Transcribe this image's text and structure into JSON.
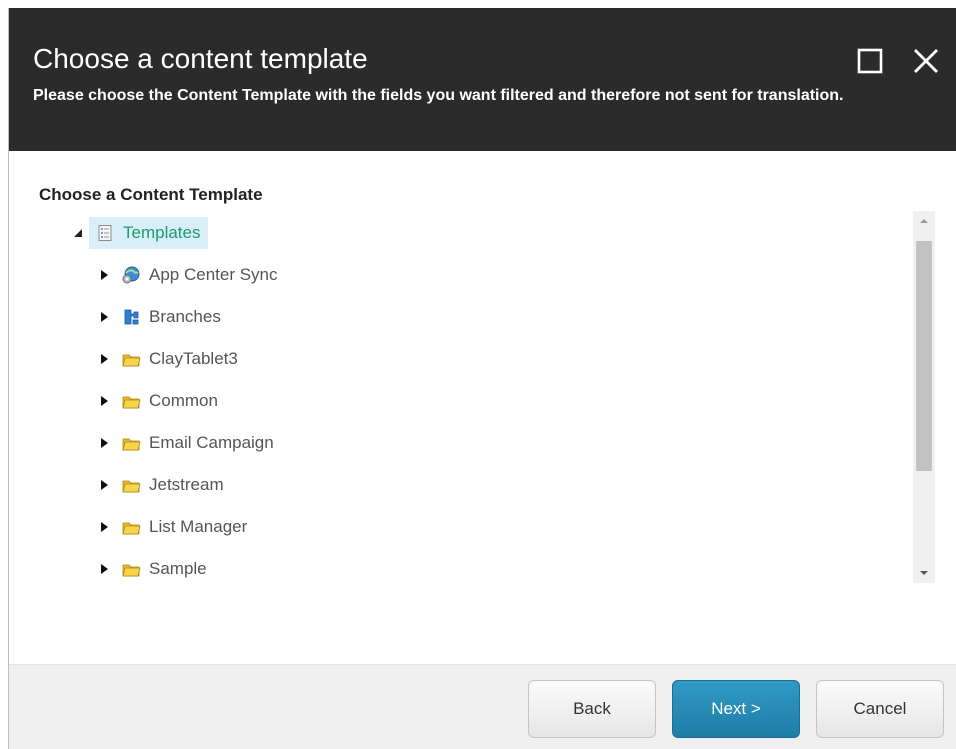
{
  "dialog": {
    "title": "Choose a content template",
    "subtitle": "Please choose the Content Template with the fields you want filtered and therefore not sent for translation."
  },
  "section": {
    "label": "Choose a Content Template"
  },
  "tree": {
    "root": {
      "label": "Templates",
      "icon": "template-icon",
      "expanded": true,
      "selected": true
    },
    "children": [
      {
        "label": "App Center Sync",
        "icon": "globe-gear-icon"
      },
      {
        "label": "Branches",
        "icon": "branches-icon"
      },
      {
        "label": "ClayTablet3",
        "icon": "folder-icon"
      },
      {
        "label": "Common",
        "icon": "folder-icon"
      },
      {
        "label": "Email Campaign",
        "icon": "folder-icon"
      },
      {
        "label": "Jetstream",
        "icon": "folder-icon"
      },
      {
        "label": "List Manager",
        "icon": "folder-icon"
      },
      {
        "label": "Sample",
        "icon": "folder-icon"
      }
    ]
  },
  "footer": {
    "back_label": "Back",
    "next_label": "Next >",
    "cancel_label": "Cancel"
  },
  "colors": {
    "header_bg": "#2b2b2b",
    "selected_bg": "#d9eef8",
    "selected_text": "#1a9c6a",
    "primary_button": "#2589b5",
    "footer_bg": "#efefef"
  }
}
